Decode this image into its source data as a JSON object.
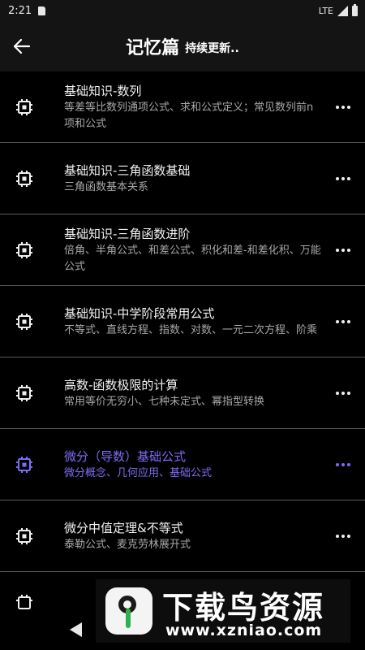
{
  "status_bar": {
    "time": "2:21",
    "network": "LTE"
  },
  "app_bar": {
    "title": "记忆篇",
    "subtitle": "持续更新.."
  },
  "items": [
    {
      "title": "基础知识-数列",
      "desc": "等差等比数列通项公式、求和公式定义；常见数列前n项和公式"
    },
    {
      "title": "基础知识-三角函数基础",
      "desc": "三角函数基本关系"
    },
    {
      "title": "基础知识-三角函数进阶",
      "desc": "倍角、半角公式、和差公式、积化和差-和差化积、万能公式"
    },
    {
      "title": "基础知识-中学阶段常用公式",
      "desc": "不等式、直线方程、指数、对数、一元二次方程、阶乘"
    },
    {
      "title": "高数-函数极限的计算",
      "desc": "常用等价无穷小、七种未定式、幂指型转换"
    },
    {
      "title": "微分（导数）基础公式",
      "desc": "微分概念、几何应用、基础公式"
    },
    {
      "title": "微分中值定理&不等式",
      "desc": "泰勒公式、麦克劳林展开式"
    }
  ],
  "highlight_color": "#7c6cf2",
  "watermark": {
    "title": "下载鸟资源",
    "url": "www.xzniao.com"
  }
}
